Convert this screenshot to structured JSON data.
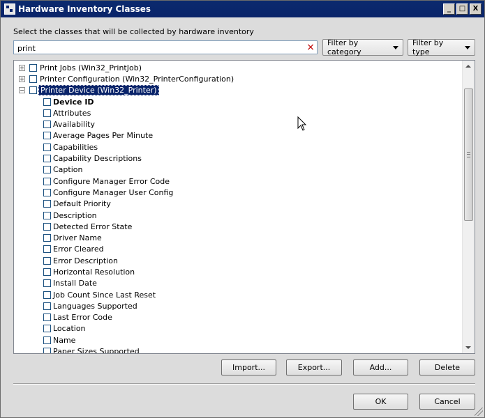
{
  "window": {
    "title": "Hardware Inventory Classes",
    "controls": [
      "_",
      "□",
      "X"
    ]
  },
  "instruction": "Select the classes that will be collected by hardware inventory",
  "search": {
    "value": "print",
    "clear_icon": "×"
  },
  "filters": {
    "category": "Filter by category",
    "type": "Filter by type"
  },
  "tree": {
    "classes": [
      {
        "label": "Print Jobs (Win32_PrintJob)",
        "expander": "+"
      },
      {
        "label": "Printer Configuration (Win32_PrinterConfiguration)",
        "expander": "+"
      },
      {
        "label": "Printer Device (Win32_Printer)",
        "expander": "−",
        "selected": true
      }
    ],
    "properties": [
      "Device ID",
      "Attributes",
      "Availability",
      "Average Pages Per Minute",
      "Capabilities",
      "Capability Descriptions",
      "Caption",
      "Configure Manager Error Code",
      "Configure Manager User Config",
      "Default Priority",
      "Description",
      "Detected Error State",
      "Driver Name",
      "Error Cleared",
      "Error Description",
      "Horizontal Resolution",
      "Install Date",
      "Job Count Since Last Reset",
      "Languages Supported",
      "Last Error Code",
      "Location",
      "Name",
      "Paper Sizes Supported"
    ]
  },
  "actions": {
    "import": "Import...",
    "export": "Export...",
    "add": "Add...",
    "delete": "Delete"
  },
  "dialog": {
    "ok": "OK",
    "cancel": "Cancel"
  }
}
